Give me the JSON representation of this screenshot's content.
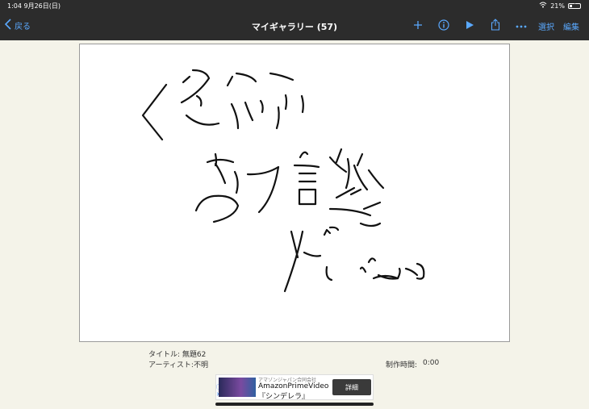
{
  "status": {
    "time": "1:04  9月26日(日)",
    "battery": "21%",
    "battery_level": 0.21
  },
  "nav": {
    "back_label": "戻る",
    "title": "マイギャラリー (57)",
    "select_label": "選択",
    "edit_label": "編集",
    "accent": "#5aa9ff"
  },
  "artwork": {
    "title": "タイトル: 無題62",
    "artist": "アーティスト:不明",
    "time_label": "制作時間:",
    "time_value": "0:00"
  },
  "ad": {
    "company": "アマゾンジャパン合同会社",
    "line1": "AmazonPrimeVideo",
    "line2": "『シンデレラ』",
    "button": "詳細"
  }
}
